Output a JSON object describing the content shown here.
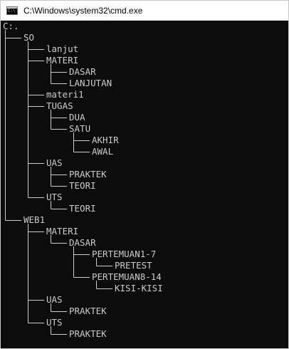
{
  "window": {
    "title": "C:\\Windows\\system32\\cmd.exe",
    "icon": "cmd-console-icon",
    "icon_glyph": "C:\\",
    "colors": {
      "background": "#0c0c0c",
      "text": "#cccccc",
      "titlebar": "#ffffff"
    }
  },
  "console": {
    "root_path": "C:.",
    "tree": [
      {
        "name": "SO",
        "depth": 0,
        "children": [
          {
            "name": "lanjut",
            "depth": 1,
            "children": []
          },
          {
            "name": "MATERI",
            "depth": 1,
            "children": [
              {
                "name": "DASAR",
                "depth": 2,
                "children": []
              },
              {
                "name": "LANJUTAN",
                "depth": 2,
                "children": []
              }
            ]
          },
          {
            "name": "materi1",
            "depth": 1,
            "children": []
          },
          {
            "name": "TUGAS",
            "depth": 1,
            "children": [
              {
                "name": "DUA",
                "depth": 2,
                "children": []
              },
              {
                "name": "SATU",
                "depth": 2,
                "children": [
                  {
                    "name": "AKHIR",
                    "depth": 3,
                    "children": []
                  },
                  {
                    "name": "AWAL",
                    "depth": 3,
                    "children": []
                  }
                ]
              }
            ]
          },
          {
            "name": "UAS",
            "depth": 1,
            "children": [
              {
                "name": "PRAKTEK",
                "depth": 2,
                "children": []
              },
              {
                "name": "TEORI",
                "depth": 2,
                "children": []
              }
            ]
          },
          {
            "name": "UTS",
            "depth": 1,
            "children": [
              {
                "name": "TEORI",
                "depth": 2,
                "children": []
              }
            ]
          }
        ]
      },
      {
        "name": "WEB1",
        "depth": 0,
        "children": [
          {
            "name": "MATERI",
            "depth": 1,
            "children": [
              {
                "name": "DASAR",
                "depth": 2,
                "children": [
                  {
                    "name": "PERTEMUAN1-7",
                    "depth": 3,
                    "children": [
                      {
                        "name": "PRETEST",
                        "depth": 4,
                        "children": []
                      }
                    ]
                  },
                  {
                    "name": "PERTEMUAN8-14",
                    "depth": 3,
                    "children": [
                      {
                        "name": "KISI-KISI",
                        "depth": 4,
                        "children": []
                      }
                    ]
                  }
                ]
              }
            ]
          },
          {
            "name": "UAS",
            "depth": 1,
            "children": [
              {
                "name": "PRAKTEK",
                "depth": 2,
                "children": []
              }
            ]
          },
          {
            "name": "UTS",
            "depth": 1,
            "children": [
              {
                "name": "PRAKTEK",
                "depth": 2,
                "children": []
              }
            ]
          }
        ]
      }
    ]
  }
}
